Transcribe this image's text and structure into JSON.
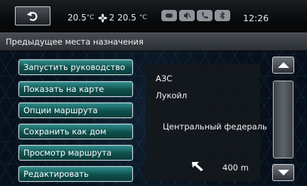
{
  "status": {
    "back_icon": "back-arrow-icon",
    "temp_left": "20.5",
    "temp_unit": "°C",
    "fan_icon": "fan-icon",
    "fan_level": "2",
    "temp_right": "20.5",
    "icons": [
      "media-icon",
      "mute-icon",
      "phone-icon",
      "bluetooth-icon"
    ],
    "clock": "12:26"
  },
  "title": "Предыдущее места назначения",
  "menu": [
    {
      "label": "Запустить руководство"
    },
    {
      "label": "Показать на карте"
    },
    {
      "label": "Опции маршрута"
    },
    {
      "label": "Сохранить как дом"
    },
    {
      "label": "Просмотр маршрута"
    },
    {
      "label": "Редактировать"
    }
  ],
  "info": {
    "category": "АЗС",
    "name": "Лукойл",
    "road": "Центральный федераль",
    "direction_icon": "direction-arrow-icon",
    "distance": "400 m"
  },
  "scrollbar": {
    "up_icon": "chevron-up-icon",
    "down_icon": "chevron-down-icon"
  },
  "colors": {
    "menu_button": "#0e4f4c",
    "background": "#07101a",
    "panel": "#14181c"
  }
}
